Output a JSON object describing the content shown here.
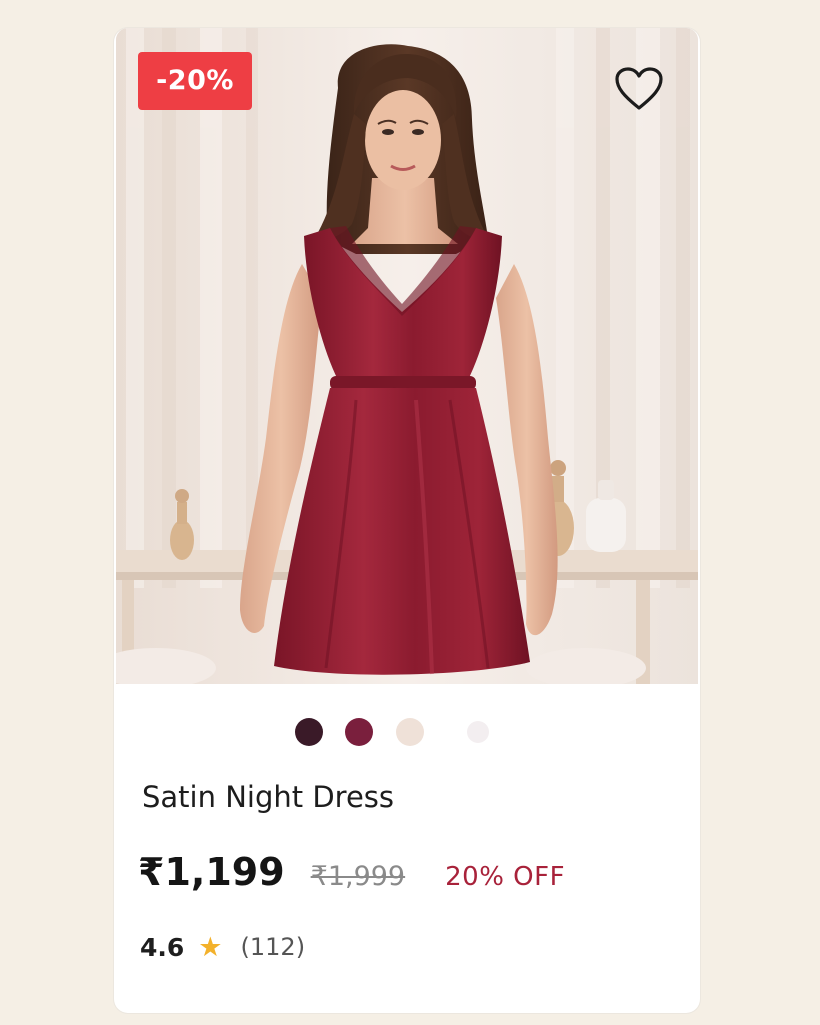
{
  "product": {
    "discount_badge": "-20%",
    "name": "Satin Night Dress",
    "price": "₹1,199",
    "original_price": "₹1,999",
    "discount_text": "20% OFF",
    "rating": "4.6",
    "review_count": "(112)",
    "image_alt": "model wearing maroon satin night dress"
  },
  "icons": {
    "wishlist": "heart-outline-icon",
    "rating": "star-icon"
  },
  "swatches": [
    {
      "name": "dark-plum",
      "color": "#3a1a28"
    },
    {
      "name": "maroon",
      "color": "#7a1f3d"
    },
    {
      "name": "beige",
      "color": "#efe1d8"
    },
    {
      "name": "white",
      "color": "#f3eef0"
    }
  ],
  "colors": {
    "badge": "#ee3e44",
    "discount_text": "#a8223a",
    "star": "#f3b12b",
    "dress": "#8e1c30",
    "page_background": "#f5efe5"
  }
}
